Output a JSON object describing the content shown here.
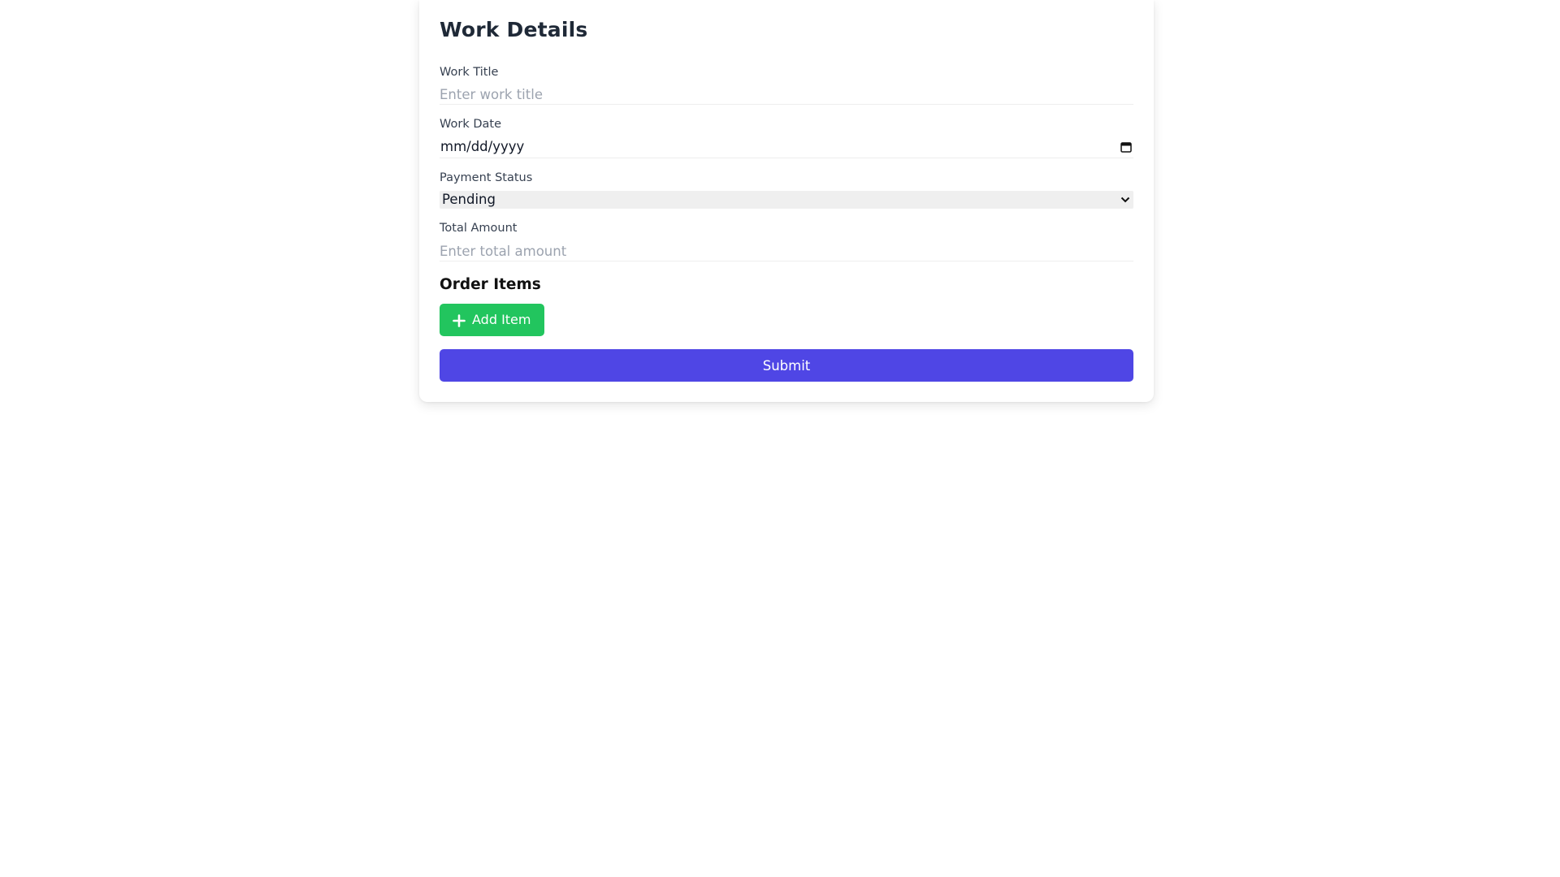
{
  "form": {
    "title": "Work Details",
    "work_title": {
      "label": "Work Title",
      "value": "",
      "placeholder": "Enter work title"
    },
    "work_date": {
      "label": "Work Date",
      "value": "mm/dd/yyyy"
    },
    "payment_status": {
      "label": "Payment Status",
      "selected": "Pending"
    },
    "total_amount": {
      "label": "Total Amount",
      "value": "",
      "placeholder": "Enter total amount"
    },
    "order_items": {
      "title": "Order Items",
      "add_label": "Add Item"
    },
    "submit_label": "Submit"
  },
  "colors": {
    "accent": "#4f46e5",
    "add_button": "#22c55e",
    "text_primary": "#1f2937",
    "placeholder": "#9ca3af"
  },
  "icons": [
    "calendar-icon",
    "chevron-down-icon",
    "plus-icon"
  ]
}
